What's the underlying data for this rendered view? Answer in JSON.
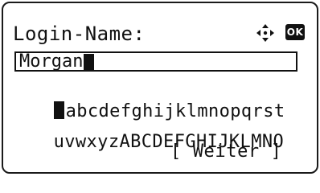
{
  "screen": {
    "title": "Login-Name:",
    "nav_icon": "four-way-arrow-icon",
    "ok_label": "OK",
    "input_value": "Morgan",
    "char_rows": [
      "abcdefghijklmnopqrst",
      "uvwxyzABCDEFGHIJKLMNO"
    ],
    "weiter_label": "[ Weiter ]"
  }
}
